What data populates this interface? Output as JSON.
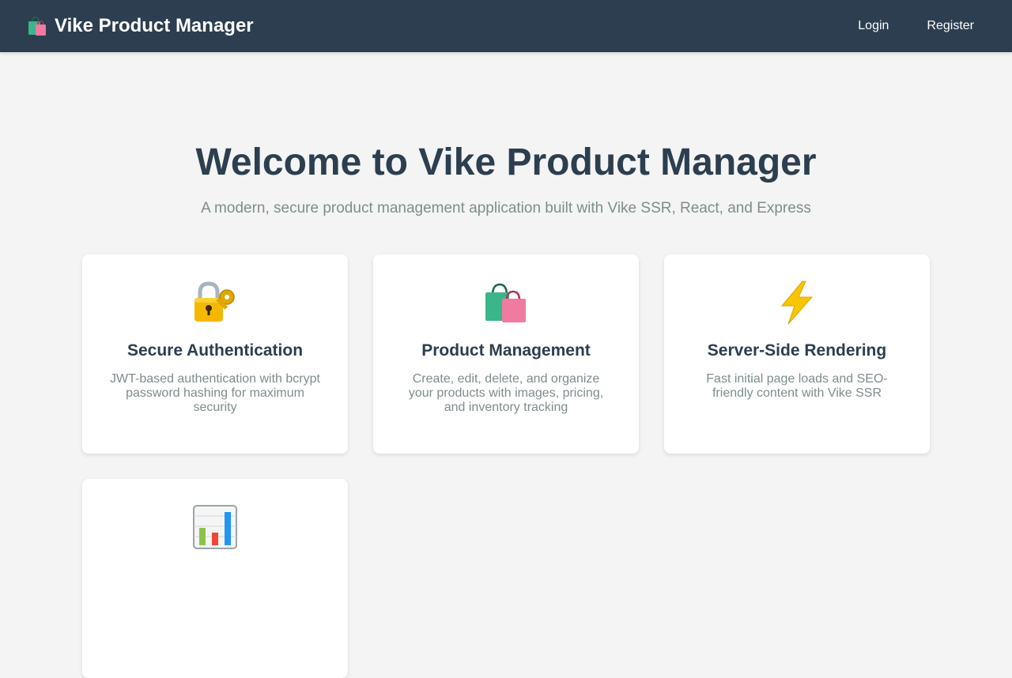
{
  "navbar": {
    "brand": {
      "icon": "shopping-bags-icon",
      "title": "Vike Product Manager"
    },
    "links": [
      {
        "label": "Login"
      },
      {
        "label": "Register"
      }
    ],
    "bg_color": "#2c3e50"
  },
  "hero": {
    "title": "Welcome to Vike Product Manager",
    "subtitle": "A modern, secure product management application built with Vike SSR, React, and Express"
  },
  "features": [
    {
      "icon": "lock-with-key-icon",
      "title": "Secure Authentication",
      "description": "JWT-based authentication with bcrypt password hashing for maximum security"
    },
    {
      "icon": "shopping-bags-icon",
      "title": "Product Management",
      "description": "Create, edit, delete, and organize your products with images, pricing, and inventory tracking"
    },
    {
      "icon": "lightning-icon",
      "title": "Server-Side Rendering",
      "description": "Fast initial page loads and SEO-friendly content with Vike SSR"
    },
    {
      "icon": "bar-chart-icon",
      "title": "",
      "description": ""
    }
  ],
  "colors": {
    "page_bg": "#f4f4f4",
    "heading": "#2c3e50",
    "muted_text": "#7f8c8d",
    "card_bg": "#ffffff"
  }
}
